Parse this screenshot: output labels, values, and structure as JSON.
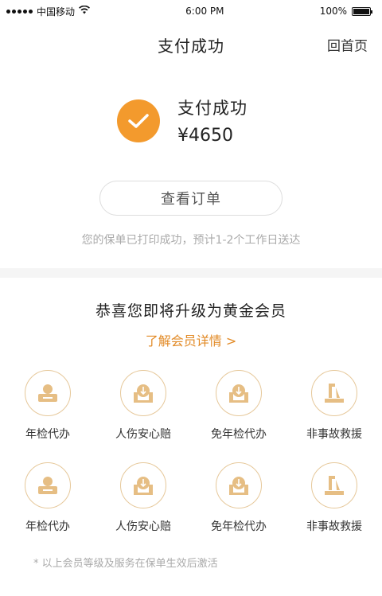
{
  "status_bar": {
    "carrier": "中国移动",
    "time": "6:00 PM",
    "battery_percent": "100%"
  },
  "nav": {
    "title": "支付成功",
    "home_label": "回首页"
  },
  "result": {
    "title": "支付成功",
    "amount": "¥4650",
    "icon": "check-icon",
    "accent_color": "#f39a2d"
  },
  "actions": {
    "view_order_label": "查看订单"
  },
  "notice": "您的保单已打印成功，预计1-2个工作日送达",
  "upgrade": {
    "title": "恭喜您即将升级为黄金会员",
    "link_label": "了解会员详情 >",
    "link_color": "#e28a26"
  },
  "benefits": [
    {
      "label": "年检代办",
      "icon": "inspection-icon"
    },
    {
      "label": "人伤安心赔",
      "icon": "injury-claim-icon"
    },
    {
      "label": "免年检代办",
      "icon": "exemption-icon"
    },
    {
      "label": "非事故救援",
      "icon": "rescue-icon"
    },
    {
      "label": "年检代办",
      "icon": "inspection-icon"
    },
    {
      "label": "人伤安心赔",
      "icon": "injury-claim-icon"
    },
    {
      "label": "免年检代办",
      "icon": "exemption-icon"
    },
    {
      "label": "非事故救援",
      "icon": "rescue-icon"
    }
  ],
  "footnote": "* 以上会员等级及服务在保单生效后激活"
}
